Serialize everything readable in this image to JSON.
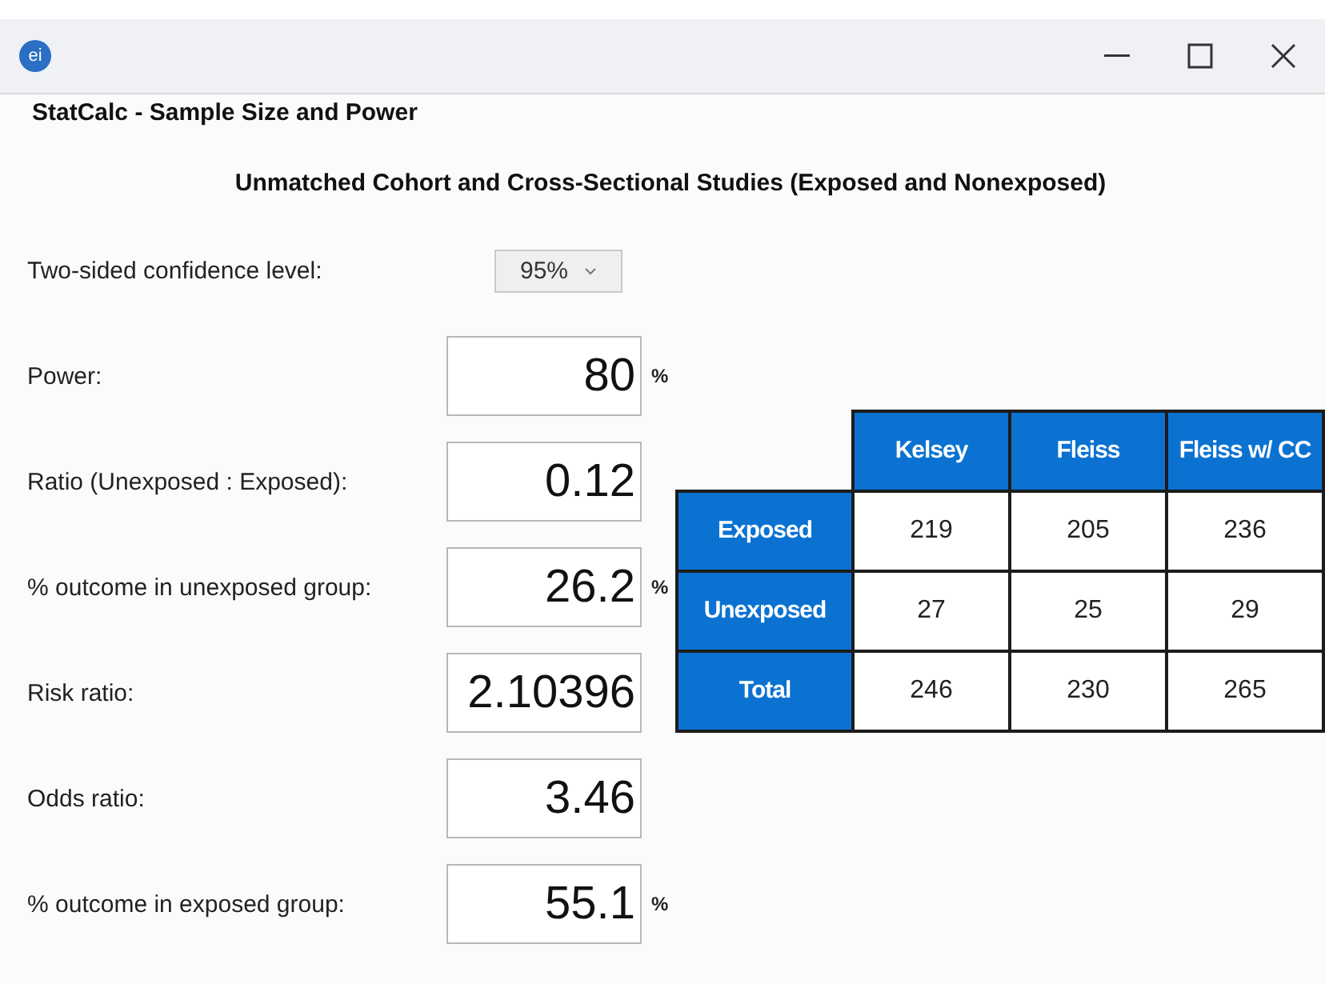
{
  "window": {
    "icon_text": "ei",
    "title": "StatCalc - Sample Size and Power"
  },
  "heading": "Unmatched Cohort and Cross-Sectional Studies (Exposed and Nonexposed)",
  "confidence": {
    "label": "Two-sided confidence level:",
    "value": "95%"
  },
  "fields": [
    {
      "label": "Power:",
      "value": "80",
      "unit": "%"
    },
    {
      "label": "Ratio (Unexposed : Exposed):",
      "value": "0.12"
    },
    {
      "label": "% outcome in unexposed group:",
      "value": "26.2",
      "unit": "%"
    },
    {
      "label": "Risk ratio:",
      "value": "2.10396"
    },
    {
      "label": "Odds ratio:",
      "value": "3.46"
    },
    {
      "label": "% outcome in exposed group:",
      "value": "55.1",
      "unit": "%"
    }
  ],
  "table": {
    "columns": [
      "Kelsey",
      "Fleiss",
      "Fleiss w/ CC"
    ],
    "rows": [
      {
        "label": "Exposed",
        "cells": [
          "219",
          "205",
          "236"
        ]
      },
      {
        "label": "Unexposed",
        "cells": [
          "27",
          "25",
          "29"
        ]
      },
      {
        "label": "Total",
        "cells": [
          "246",
          "230",
          "265"
        ]
      }
    ]
  }
}
